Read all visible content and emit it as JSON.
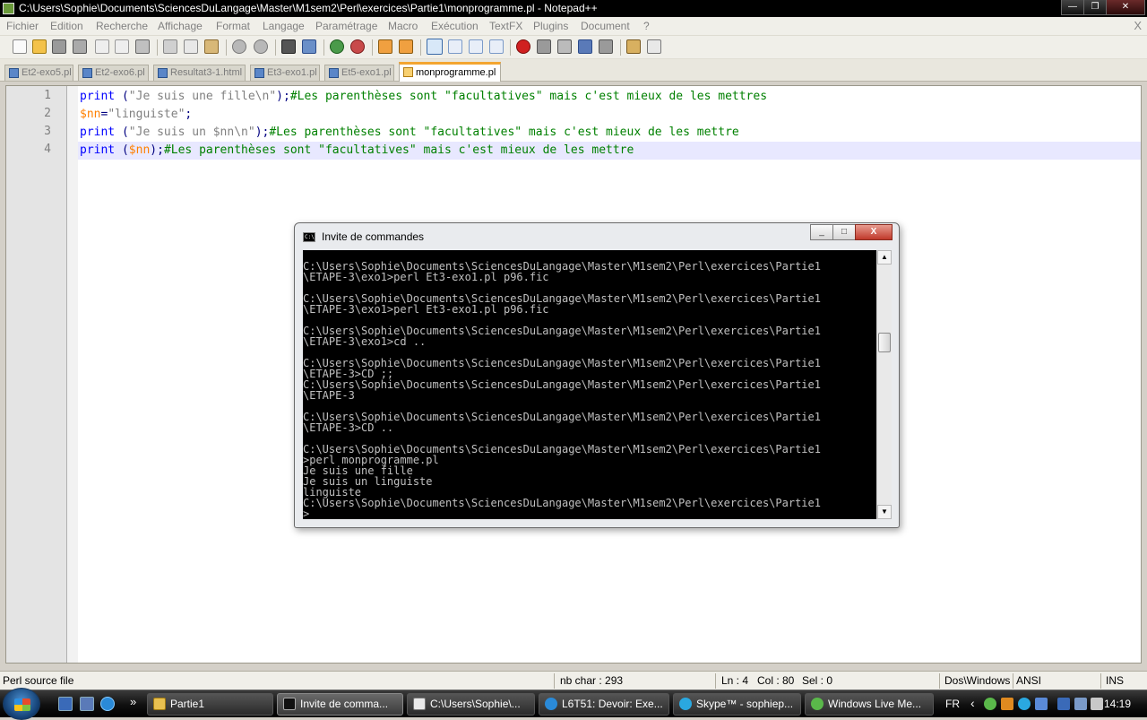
{
  "window": {
    "title": "C:\\Users\\Sophie\\Documents\\SciencesDuLangage\\Master\\M1sem2\\Perl\\exercices\\Partie1\\monprogramme.pl - Notepad++",
    "minimize": "—",
    "maximize": "❐",
    "close": "✕"
  },
  "menu": {
    "items": [
      "Fichier",
      "Edition",
      "Recherche",
      "Affichage",
      "Format",
      "Langage",
      "Paramétrage",
      "Macro",
      "Exécution",
      "TextFX",
      "Plugins",
      "Document",
      "?"
    ],
    "close": "X"
  },
  "toolbar": {
    "icons": [
      "new-file-icon",
      "open-file-icon",
      "save-icon",
      "save-all-icon",
      "close-icon",
      "close-all-icon",
      "print-icon",
      "cut-icon",
      "copy-icon",
      "paste-icon",
      "undo-icon",
      "redo-icon",
      "find-icon",
      "replace-icon",
      "zoom-in-icon",
      "zoom-out-icon",
      "sync-vertical-icon",
      "sync-horizontal-icon",
      "word-wrap-icon",
      "show-all-chars-icon",
      "indent-guide-icon",
      "user-lang-icon",
      "macro-record-icon",
      "macro-stop-icon",
      "macro-play-icon",
      "macro-run-multiple-icon",
      "macro-save-icon",
      "spell-check-icon",
      "launch-icon"
    ]
  },
  "tabs": [
    {
      "label": "Et2-exo5.pl",
      "active": false
    },
    {
      "label": "Et2-exo6.pl",
      "active": false
    },
    {
      "label": "Resultat3-1.html",
      "active": false
    },
    {
      "label": "Et3-exo1.pl",
      "active": false
    },
    {
      "label": "Et5-exo1.pl",
      "active": false
    },
    {
      "label": "monprogramme.pl",
      "active": true
    }
  ],
  "editor": {
    "line_numbers": [
      "1",
      "2",
      "3",
      "4"
    ],
    "current_line": 4,
    "lines": [
      [
        {
          "t": "print",
          "c": "kw"
        },
        {
          "t": " (",
          "c": "op"
        },
        {
          "t": "\"Je suis une fille\\n\"",
          "c": "str"
        },
        {
          "t": ");",
          "c": "op"
        },
        {
          "t": "#Les parenthèses sont \"facultatives\" mais c'est mieux de les mettres",
          "c": "com"
        }
      ],
      [
        {
          "t": "$nn",
          "c": "var"
        },
        {
          "t": "=",
          "c": "op"
        },
        {
          "t": "\"linguiste\"",
          "c": "str"
        },
        {
          "t": ";",
          "c": "op"
        }
      ],
      [
        {
          "t": "print",
          "c": "kw"
        },
        {
          "t": " (",
          "c": "op"
        },
        {
          "t": "\"Je suis un $nn\\n\"",
          "c": "str"
        },
        {
          "t": ");",
          "c": "op"
        },
        {
          "t": "#Les parenthèses sont \"facultatives\" mais c'est mieux de les mettre",
          "c": "com"
        }
      ],
      [
        {
          "t": "print",
          "c": "kw"
        },
        {
          "t": " (",
          "c": "op"
        },
        {
          "t": "$nn",
          "c": "var"
        },
        {
          "t": ");",
          "c": "op"
        },
        {
          "t": "#Les parenthèses sont \"facultatives\" mais c'est mieux de les mettre",
          "c": "com"
        }
      ]
    ]
  },
  "cmd": {
    "title": "Invite de commandes",
    "lines": [
      "",
      "C:\\Users\\Sophie\\Documents\\SciencesDuLangage\\Master\\M1sem2\\Perl\\exercices\\Partie1",
      "\\ETAPE-3\\exo1>perl Et3-exo1.pl p96.fic",
      "",
      "C:\\Users\\Sophie\\Documents\\SciencesDuLangage\\Master\\M1sem2\\Perl\\exercices\\Partie1",
      "\\ETAPE-3\\exo1>perl Et3-exo1.pl p96.fic",
      "",
      "C:\\Users\\Sophie\\Documents\\SciencesDuLangage\\Master\\M1sem2\\Perl\\exercices\\Partie1",
      "\\ETAPE-3\\exo1>cd ..",
      "",
      "C:\\Users\\Sophie\\Documents\\SciencesDuLangage\\Master\\M1sem2\\Perl\\exercices\\Partie1",
      "\\ETAPE-3>CD ;;",
      "C:\\Users\\Sophie\\Documents\\SciencesDuLangage\\Master\\M1sem2\\Perl\\exercices\\Partie1",
      "\\ETAPE-3",
      "",
      "C:\\Users\\Sophie\\Documents\\SciencesDuLangage\\Master\\M1sem2\\Perl\\exercices\\Partie1",
      "\\ETAPE-3>CD ..",
      "",
      "C:\\Users\\Sophie\\Documents\\SciencesDuLangage\\Master\\M1sem2\\Perl\\exercices\\Partie1",
      ">perl monprogramme.pl",
      "Je suis une fille",
      "Je suis un linguiste",
      "linguiste",
      "C:\\Users\\Sophie\\Documents\\SciencesDuLangage\\Master\\M1sem2\\Perl\\exercices\\Partie1",
      ">_"
    ],
    "scroll_up": "▲",
    "scroll_down": "▼",
    "min": "_",
    "max": "□",
    "close": "X"
  },
  "status": {
    "file_type": "Perl source file",
    "nb_char": "nb char : 293",
    "ln": "Ln : 4",
    "col": "Col : 80",
    "sel": "Sel : 0",
    "eol": "Dos\\Windows",
    "encoding": "ANSI",
    "mode": "INS"
  },
  "taskbar": {
    "quick_launch": [
      "show-desktop-icon",
      "switch-windows-icon",
      "internet-explorer-icon"
    ],
    "more": "»",
    "items": [
      {
        "label": "Partie1",
        "icon": "folder-icon"
      },
      {
        "label": "Invite de comma...",
        "icon": "cmd-icon"
      },
      {
        "label": "C:\\Users\\Sophie\\...",
        "icon": "notepad-icon"
      },
      {
        "label": "L6T51: Devoir: Exe...",
        "icon": "ie-icon"
      },
      {
        "label": "Skype™ - sophiep...",
        "icon": "skype-icon"
      },
      {
        "label": "Windows Live Me...",
        "icon": "messenger-icon"
      }
    ],
    "language": "FR",
    "tray_arrow": "‹",
    "tray_icons": [
      "messenger-tray-icon",
      "security-tray-icon",
      "skype-tray-icon",
      "network-tray-icon",
      "bluetooth-tray-icon",
      "device-tray-icon",
      "volume-tray-icon"
    ],
    "clock": "14:19"
  },
  "colors": {
    "keyword": "#0000ff",
    "string": "#808080",
    "variable": "#ff8000",
    "comment": "#008000",
    "tab_active_accent": "#f3a530",
    "current_line_bg": "#e8e8ff"
  }
}
